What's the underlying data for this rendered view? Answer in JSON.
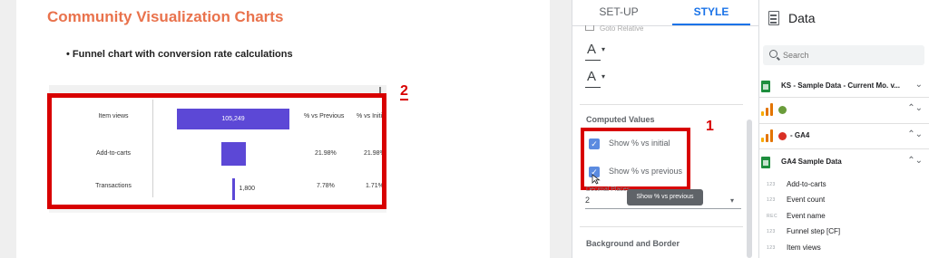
{
  "report": {
    "title": "Community Visualization Charts",
    "bullet": "• Funnel chart with conversion rate calculations"
  },
  "funnel": {
    "columns": [
      "% vs Previous",
      "% vs Initial"
    ],
    "rows": [
      {
        "label": "Item views",
        "value": "105,249",
        "vs_previous": "",
        "vs_initial": ""
      },
      {
        "label": "Add-to-carts",
        "value": "23,138",
        "vs_previous": "21.98%",
        "vs_initial": "21.98%"
      },
      {
        "label": "Transactions",
        "value": "1,800",
        "vs_previous": "7.78%",
        "vs_initial": "1.71%"
      }
    ],
    "bar_fraction": [
      1.0,
      0.22,
      0.017
    ]
  },
  "annotations": {
    "badge_2": "2",
    "badge_1": "1"
  },
  "properties": {
    "tabs": [
      "SET-UP",
      "STYLE"
    ],
    "active_tab": "STYLE",
    "cut_label": "Goto Relative",
    "font_letter": "A",
    "caret": "▾",
    "computed_title": "Computed Values",
    "show_vs_initial": "Show % vs initial",
    "show_vs_previous": "Show % vs previous",
    "tooltip": "Show % vs previous",
    "sub_label": "Decimal Places",
    "decimal_value": "2",
    "background_title": "Background and Border",
    "accent_color": "#1a73e8",
    "highlight_color": "#d80000"
  },
  "data_panel": {
    "title": "Data",
    "search_placeholder": "Search",
    "sources": [
      {
        "label": "KS - Sample Data - Current Mo. v...",
        "caret": "⌄"
      },
      {
        "label": "",
        "caret": "⌃⌄"
      },
      {
        "label": "- GA4",
        "caret": "⌃⌄"
      },
      {
        "label": "GA4 Sample Data",
        "caret": "⌃⌄"
      }
    ],
    "fields": [
      {
        "type": "123",
        "name": "Add-to-carts"
      },
      {
        "type": "123",
        "name": "Event count"
      },
      {
        "type": "REC",
        "name": "Event name"
      },
      {
        "type": "123",
        "name": "Funnel step [CF]"
      },
      {
        "type": "123",
        "name": "Item views"
      }
    ]
  }
}
